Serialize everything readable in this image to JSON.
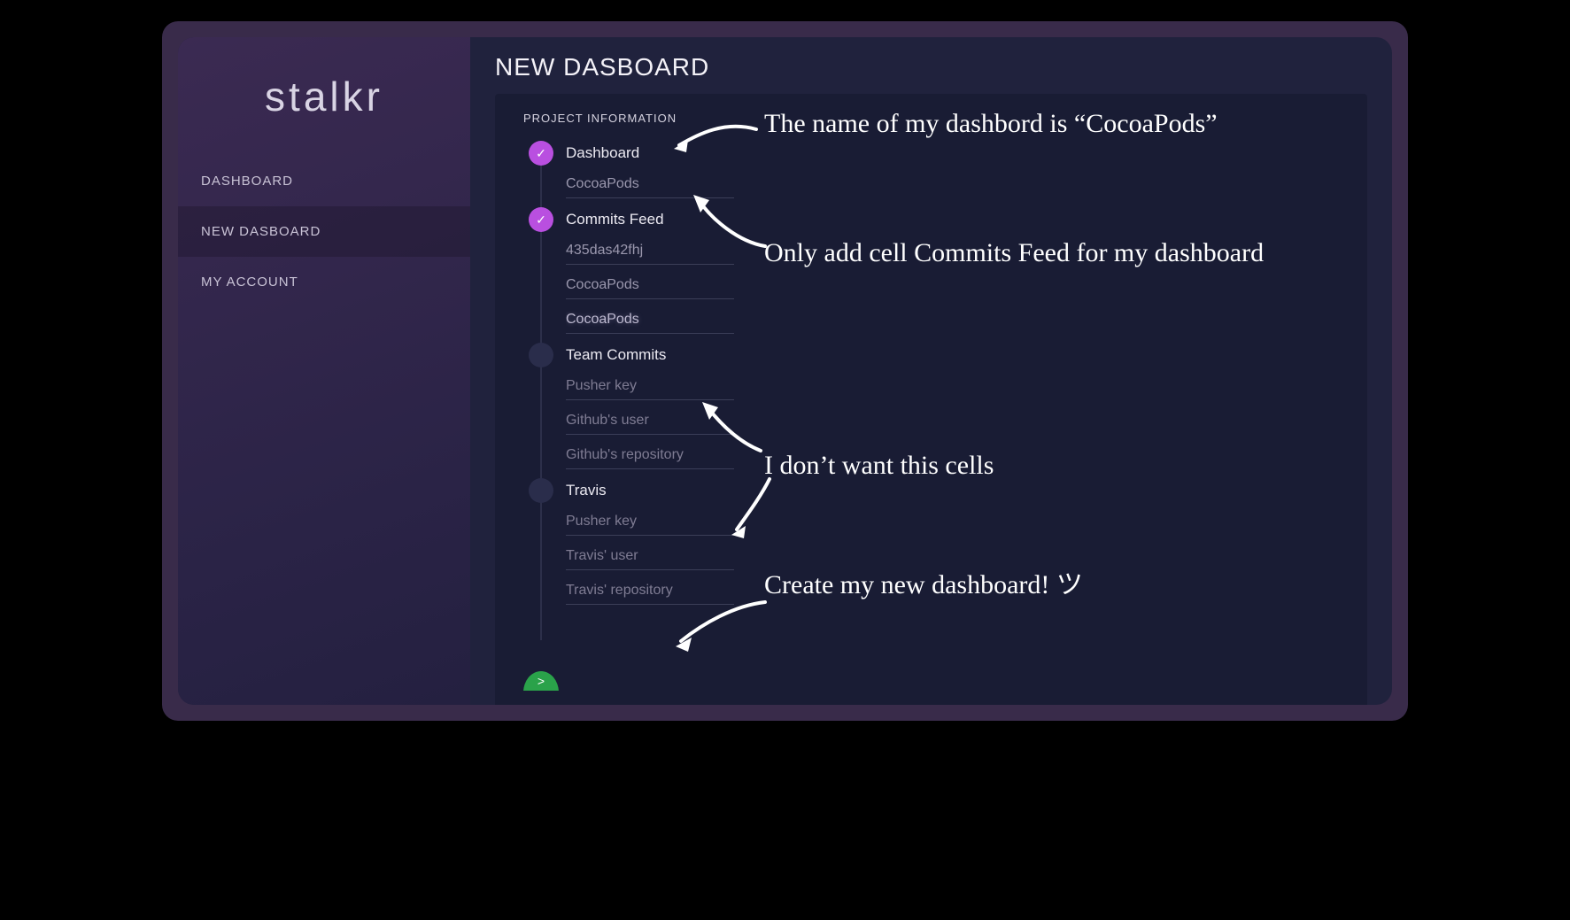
{
  "brand": "stalkr",
  "sidebar": {
    "items": [
      {
        "label": "DASHBOARD"
      },
      {
        "label": "NEW DASBOARD"
      },
      {
        "label": "MY ACCOUNT"
      }
    ],
    "activeIndex": 1
  },
  "page": {
    "title": "NEW DASBOARD"
  },
  "panel": {
    "heading": "PROJECT INFORMATION",
    "submitGlyph": ">",
    "steps": [
      {
        "title": "Dashboard",
        "status": "done",
        "fields": [
          {
            "value": "CocoaPods",
            "placeholder": ""
          }
        ]
      },
      {
        "title": "Commits Feed",
        "status": "done",
        "fields": [
          {
            "value": "435das42fhj",
            "placeholder": ""
          },
          {
            "value": "CocoaPods",
            "placeholder": ""
          },
          {
            "value": "CocoaPods",
            "placeholder": "",
            "glow": true
          }
        ]
      },
      {
        "title": "Team Commits",
        "status": "pending",
        "fields": [
          {
            "value": "",
            "placeholder": "Pusher key"
          },
          {
            "value": "",
            "placeholder": "Github's user"
          },
          {
            "value": "",
            "placeholder": "Github's repository"
          }
        ]
      },
      {
        "title": "Travis",
        "status": "pending",
        "fields": [
          {
            "value": "",
            "placeholder": "Pusher key"
          },
          {
            "value": "",
            "placeholder": "Travis' user"
          },
          {
            "value": "",
            "placeholder": "Travis' repository"
          }
        ]
      }
    ]
  },
  "annotations": {
    "a1": "The name of my dashbord is “CocoaPods”",
    "a2": "Only add cell Commits Feed for my dashboard",
    "a3": "I don’t want this cells",
    "a4": "Create my new dashboard! ツ"
  },
  "icons": {
    "check": "✓"
  }
}
